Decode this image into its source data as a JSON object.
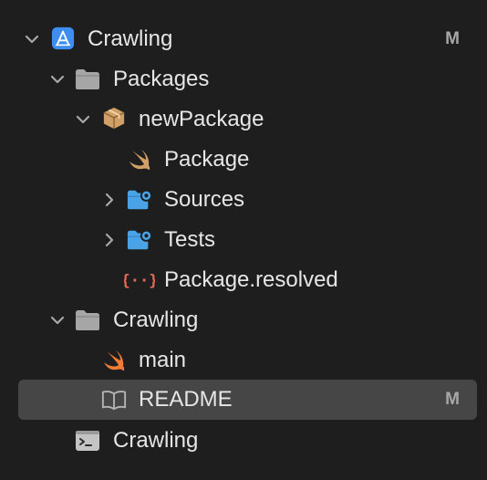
{
  "tree": {
    "project": {
      "label": "Crawling",
      "badge": "M"
    },
    "packages_group": {
      "label": "Packages"
    },
    "package": {
      "label": "newPackage"
    },
    "package_manifest": {
      "label": "Package"
    },
    "sources_folder": {
      "label": "Sources"
    },
    "tests_folder": {
      "label": "Tests"
    },
    "resolved_file": {
      "label": "Package.resolved"
    },
    "crawling_group": {
      "label": "Crawling"
    },
    "main_file": {
      "label": "main"
    },
    "readme_file": {
      "label": "README",
      "badge": "M"
    },
    "target": {
      "label": "Crawling"
    }
  },
  "colors": {
    "background": "#1e1e1e",
    "selection": "#464646",
    "text": "#e6e6e6",
    "badge": "#a8a8a8",
    "project_icon": "#3d8ef0",
    "folder": "#a6a6a6",
    "blue_folder": "#4aa3e6",
    "package_box": "#d0a066",
    "swift": "#f27b35",
    "json": "#e56a55"
  }
}
